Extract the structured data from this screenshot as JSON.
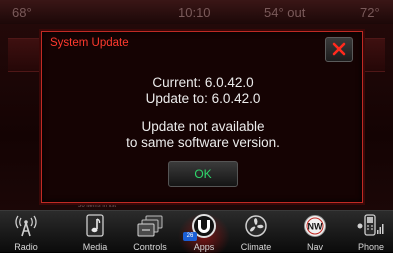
{
  "status_bar": {
    "temp_left": "68°",
    "clock": "10:10",
    "outside_temp": "54° out",
    "temp_right": "72°"
  },
  "background": {
    "status_text": "36 items in list"
  },
  "dialog": {
    "title": "System Update",
    "current_line": "Current: 6.0.42.0",
    "update_line": "Update to: 6.0.42.0",
    "message_line1": "Update not available",
    "message_line2": "to same software version.",
    "ok_label": "OK"
  },
  "dock": {
    "items": [
      {
        "label": "Radio",
        "icon": "radio-tower-icon"
      },
      {
        "label": "Media",
        "icon": "music-note-icon"
      },
      {
        "label": "Controls",
        "icon": "controls-icon"
      },
      {
        "label": "Apps",
        "icon": "apps-u-icon",
        "badge": "26",
        "active": true
      },
      {
        "label": "Climate",
        "icon": "climate-fan-icon"
      },
      {
        "label": "Nav",
        "icon": "compass-nw-icon",
        "compass_text": "NW"
      },
      {
        "label": "Phone",
        "icon": "phone-icon"
      }
    ]
  },
  "colors": {
    "title_red": "#ff3a2e",
    "dialog_border": "#c02a24",
    "ok_green": "#2ed66a",
    "apps_badge_blue": "#1b5fd6"
  }
}
